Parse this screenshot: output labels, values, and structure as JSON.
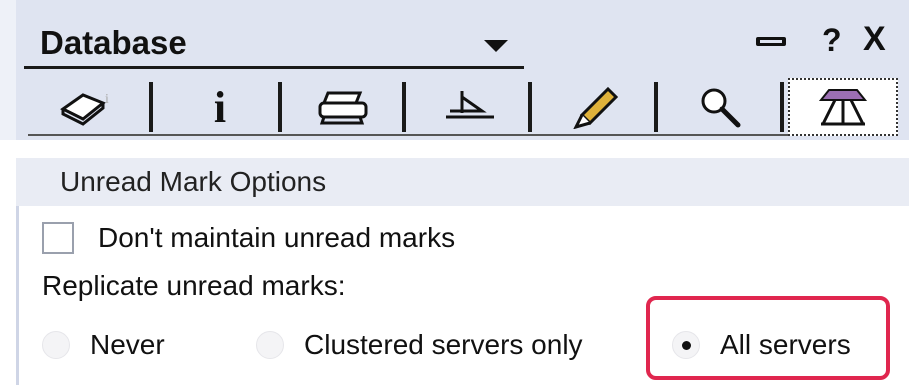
{
  "header": {
    "title": "Database",
    "help_glyph": "?",
    "close_glyph": "X"
  },
  "tabs": [
    {
      "icon": "book-icon",
      "active": false
    },
    {
      "icon": "info-icon",
      "glyph": "i",
      "active": false
    },
    {
      "icon": "printer-icon",
      "active": false
    },
    {
      "icon": "design-icon",
      "active": false
    },
    {
      "icon": "pen-icon",
      "active": false
    },
    {
      "icon": "search-icon",
      "active": false
    },
    {
      "icon": "replication-icon",
      "active": true
    }
  ],
  "section": {
    "title": "Unread Mark Options",
    "checkbox_label": "Don't maintain unread marks",
    "checkbox_checked": false,
    "replicate_label": "Replicate unread marks:",
    "options": [
      {
        "label": "Never",
        "selected": false
      },
      {
        "label": "Clustered servers only",
        "selected": false
      },
      {
        "label": "All servers",
        "selected": true
      }
    ]
  },
  "colors": {
    "header_bg": "#dfe4f1",
    "highlight": "#e0264e"
  }
}
